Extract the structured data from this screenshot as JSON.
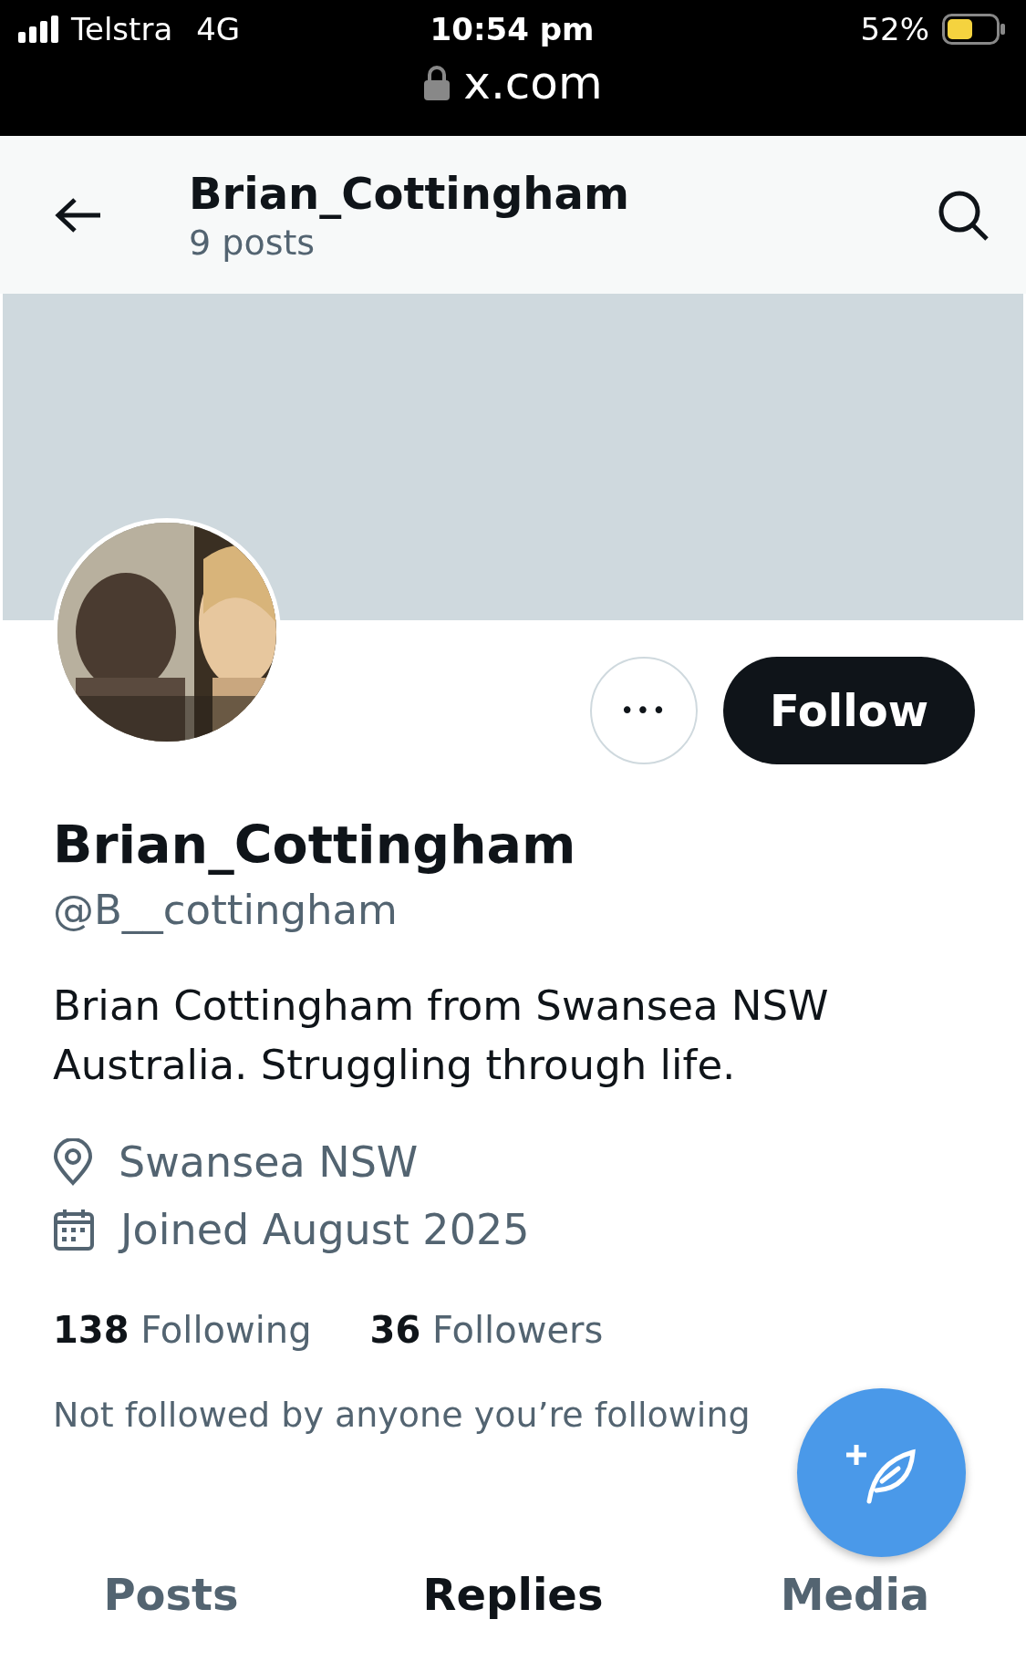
{
  "status_bar": {
    "carrier": "Telstra",
    "network": "4G",
    "time": "10:54 pm",
    "battery": "52%",
    "url": "x.com"
  },
  "header": {
    "title": "Brian_Cottingham",
    "subtitle": "9 posts"
  },
  "profile": {
    "name": "Brian_Cottingham",
    "handle": "@B__cottingham",
    "bio": "Brian Cottingham from Swansea NSW Australia. Struggling through life.",
    "location": "Swansea NSW",
    "joined": "Joined August 2025",
    "stats": [
      {
        "count": "138",
        "label": "Following"
      },
      {
        "count": "36",
        "label": "Followers"
      }
    ],
    "follow_button": "Follow",
    "more_button": "•••",
    "mutuals": "Not followed by anyone you’re following"
  },
  "tabs": [
    {
      "label": "Posts",
      "selected": false
    },
    {
      "label": "Replies",
      "selected": true
    },
    {
      "label": "Media",
      "selected": false
    }
  ]
}
